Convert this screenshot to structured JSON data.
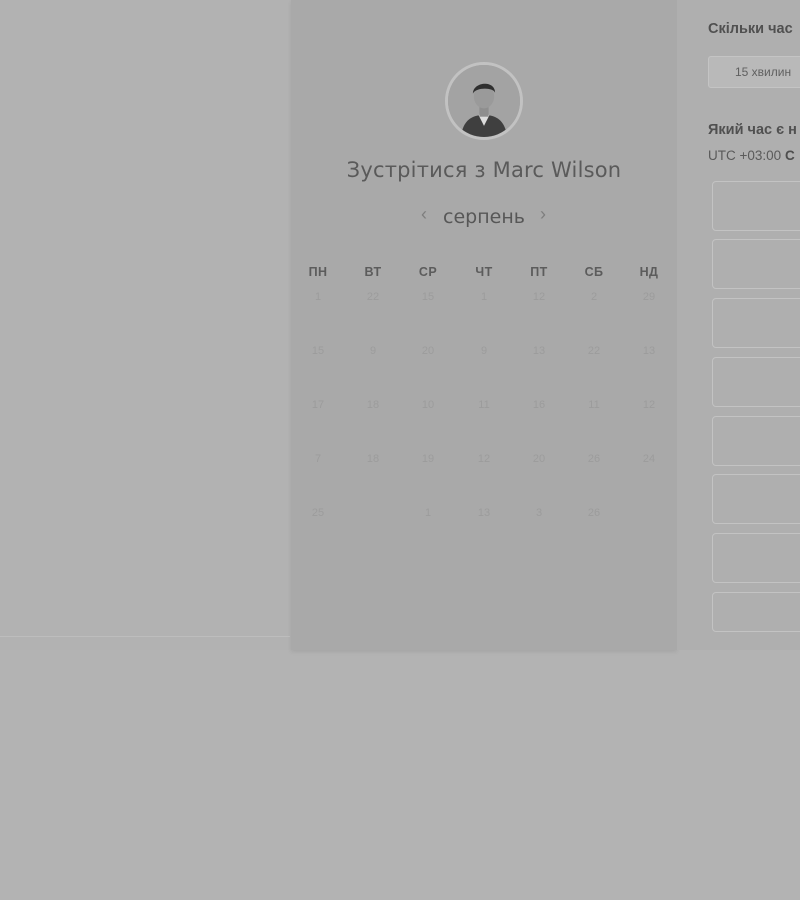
{
  "host": {
    "title": "Зустрітися з Marc Wilson"
  },
  "calendar": {
    "month": "серпень",
    "prev_icon": "chevron-left-icon",
    "next_icon": "chevron-right-icon",
    "weekdays": [
      "ПН",
      "ВТ",
      "СР",
      "ЧТ",
      "ПТ",
      "СБ",
      "НД"
    ],
    "rows": [
      [
        "1",
        "22",
        "15",
        "1",
        "12",
        "2",
        "29"
      ],
      [
        "15",
        "9",
        "20",
        "9",
        "13",
        "22",
        "13"
      ],
      [
        "17",
        "18",
        "10",
        "11",
        "16",
        "11",
        "12"
      ],
      [
        "7",
        "18",
        "19",
        "12",
        "20",
        "26",
        "24"
      ],
      [
        "25",
        "",
        "1",
        "13",
        "3",
        "26",
        ""
      ]
    ]
  },
  "booking": {
    "duration_question": "Скільки час",
    "duration_value": "15 хвилин",
    "time_question": "Який час є н",
    "timezone": "UTC +03:00",
    "timezone_suffix": "С"
  }
}
